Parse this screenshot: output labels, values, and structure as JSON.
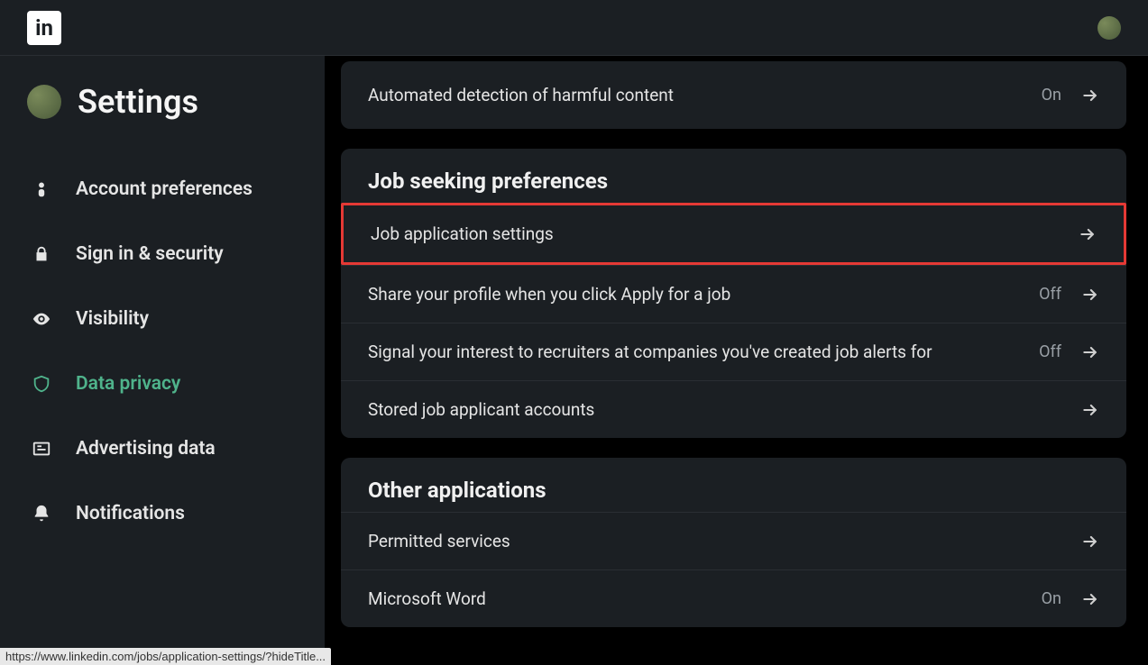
{
  "header": {
    "logo_text": "in"
  },
  "sidebar": {
    "title": "Settings",
    "items": [
      {
        "label": "Account preferences"
      },
      {
        "label": "Sign in & security"
      },
      {
        "label": "Visibility"
      },
      {
        "label": "Data privacy"
      },
      {
        "label": "Advertising data"
      },
      {
        "label": "Notifications"
      }
    ]
  },
  "main": {
    "partial_row": {
      "label": "Automated detection of harmful content",
      "status": "On"
    },
    "sections": [
      {
        "title": "Job seeking preferences",
        "rows": [
          {
            "label": "Job application settings",
            "status": "",
            "highlighted": true
          },
          {
            "label": "Share your profile when you click Apply for a job",
            "status": "Off"
          },
          {
            "label": "Signal your interest to recruiters at companies you've created job alerts for",
            "status": "Off"
          },
          {
            "label": "Stored job applicant accounts",
            "status": ""
          }
        ]
      },
      {
        "title": "Other applications",
        "rows": [
          {
            "label": "Permitted services",
            "status": ""
          },
          {
            "label": "Microsoft Word",
            "status": "On"
          }
        ]
      }
    ]
  },
  "status_url": "https://www.linkedin.com/jobs/application-settings/?hideTitle..."
}
